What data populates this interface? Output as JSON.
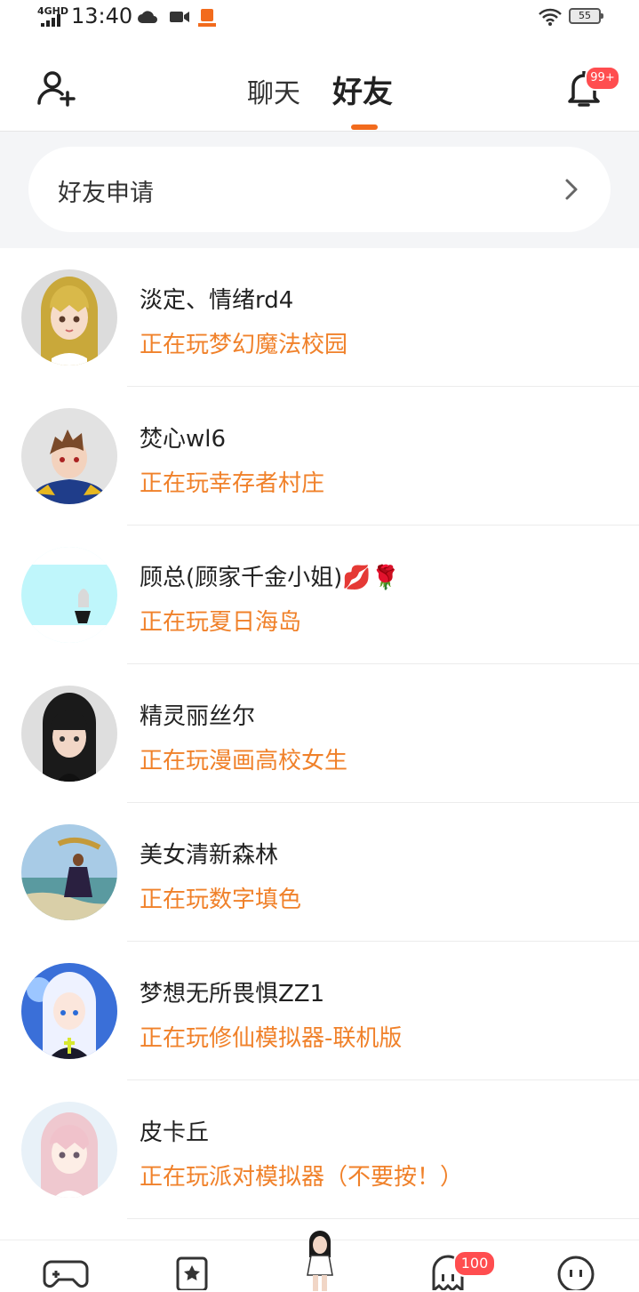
{
  "status_bar": {
    "network": "4GHD",
    "time": "13:40",
    "battery": "55"
  },
  "header": {
    "tabs": [
      {
        "label": "聊天",
        "active": false
      },
      {
        "label": "好友",
        "active": true
      }
    ],
    "notification_badge": "99+",
    "accent": "#f26b1d"
  },
  "friend_request": {
    "label": "好友申请"
  },
  "friends": [
    {
      "name": "淡定、情绪rd4",
      "status": "正在玩梦幻魔法校园"
    },
    {
      "name": "焚心wl6",
      "status": "正在玩幸存者村庄"
    },
    {
      "name": "顾总(顾家千金小姐)💋🌹",
      "status": "正在玩夏日海岛"
    },
    {
      "name": "精灵丽丝尔",
      "status": "正在玩漫画高校女生"
    },
    {
      "name": "美女清新森林",
      "status": "正在玩数字填色"
    },
    {
      "name": "梦想无所畏惧ZZ1",
      "status": "正在玩修仙模拟器-联机版"
    },
    {
      "name": "皮卡丘",
      "status": "正在玩派对模拟器（不要按！）"
    }
  ],
  "bottom_nav": {
    "items": [
      "gamepad-icon",
      "star-card-icon",
      "avatar-character",
      "ghost-icon",
      "chat-face-icon"
    ],
    "ghost_badge": "100"
  }
}
